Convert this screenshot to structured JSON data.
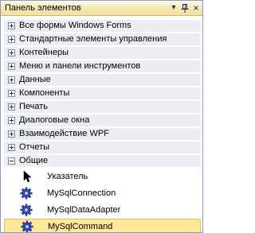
{
  "panel": {
    "title": "Панель элементов",
    "buttons": {
      "dropdown_icon": "▾",
      "pin_icon": "ᵠ",
      "close_icon": "×"
    }
  },
  "categories": [
    {
      "label": "Все формы Windows Forms",
      "state": "collapsed"
    },
    {
      "label": "Стандартные элементы управления",
      "state": "collapsed"
    },
    {
      "label": "Контейнеры",
      "state": "collapsed"
    },
    {
      "label": "Меню и панели инструментов",
      "state": "collapsed"
    },
    {
      "label": "Данные",
      "state": "collapsed"
    },
    {
      "label": "Компоненты",
      "state": "collapsed"
    },
    {
      "label": "Печать",
      "state": "collapsed"
    },
    {
      "label": "Диалоговые окна",
      "state": "collapsed"
    },
    {
      "label": "Взаимодействие WPF",
      "state": "collapsed"
    },
    {
      "label": "Отчеты",
      "state": "collapsed"
    },
    {
      "label": "Общие",
      "state": "expanded"
    }
  ],
  "items": [
    {
      "label": "Указатель",
      "icon": "pointer-icon"
    },
    {
      "label": "MySqlConnection",
      "icon": "component-gear-icon"
    },
    {
      "label": "MySqlDataAdapter",
      "icon": "component-gear-icon"
    },
    {
      "label": "MySqlCommand",
      "icon": "component-gear-icon",
      "selected": true
    }
  ],
  "colors": {
    "title_bg": "#f5eab8",
    "category_bg": "#eceef3",
    "selected_bg": "#ffe79a",
    "selected_border": "#e5c365"
  }
}
